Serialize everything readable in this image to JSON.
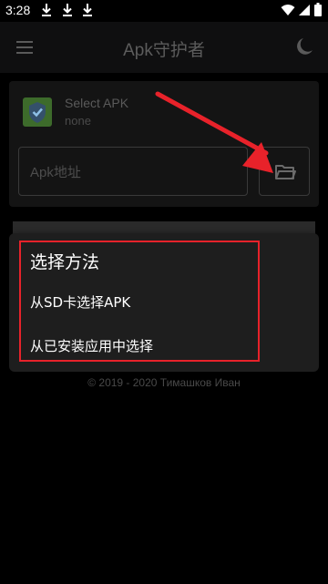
{
  "status_bar": {
    "time": "3:28",
    "download_icons": [
      "download-icon",
      "download-icon",
      "download-icon"
    ],
    "right_icons": [
      "wifi-icon",
      "signal-icon",
      "battery-icon"
    ]
  },
  "toolbar": {
    "title": "Apk守护者",
    "menu_icon": "menu-icon",
    "theme_icon": "moon-icon"
  },
  "apk_card": {
    "name": "Select APK",
    "version": "none",
    "path_placeholder": "Apk地址",
    "folder_icon": "folder-icon"
  },
  "dialog": {
    "title": "选择方法",
    "options": [
      "从SD卡选择APK",
      "从已安装应用中选择"
    ]
  },
  "footer": {
    "copyright": "© 2019 - 2020 Тимашков Иван"
  },
  "colors": {
    "annotation_red": "#e8222a",
    "background": "#000000",
    "dialog_bg": "#1e1e1e",
    "card_bg": "#141414"
  }
}
